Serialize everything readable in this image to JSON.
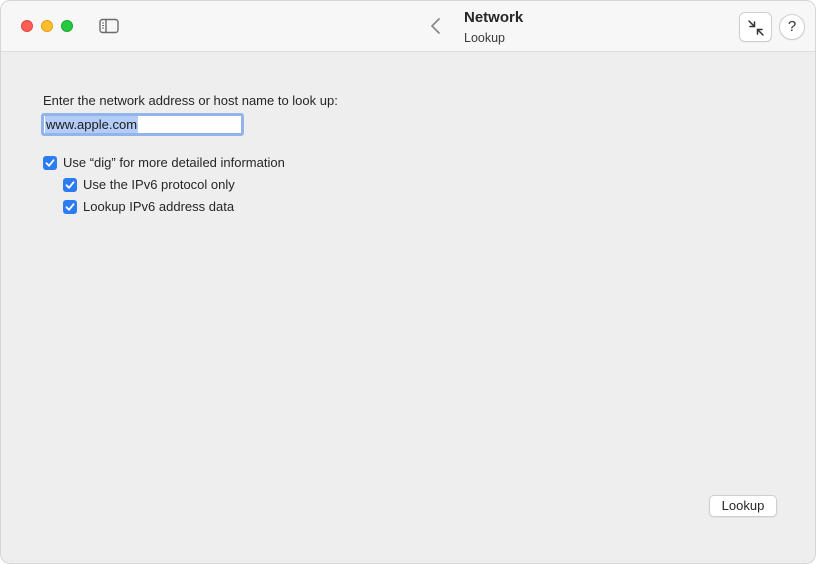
{
  "window": {
    "traffic_lights": {
      "close_color": "#ff5f57",
      "minimize_color": "#febc2e",
      "maximize_color": "#28c840"
    },
    "title": "Network",
    "subtitle": "Lookup",
    "toolbar_icons": {
      "sidebar": "sidebar-toggle-icon",
      "back": "chevron-left-icon",
      "collapse": "arrows-compress-icon",
      "help": "?"
    }
  },
  "form": {
    "prompt": "Enter the network address or host name to look up:",
    "address_value": "www.apple.com",
    "options": [
      {
        "label": "Use “dig” for more detailed information",
        "checked": true
      },
      {
        "label": "Use the IPv6 protocol only",
        "checked": true
      },
      {
        "label": "Lookup IPv6 address data",
        "checked": true
      }
    ],
    "lookup_button": "Lookup"
  },
  "colors": {
    "accent": "#2b7bf3",
    "selection": "#b3cdf6",
    "focus_ring": "#93b4ea",
    "background": "#eeeeee"
  }
}
